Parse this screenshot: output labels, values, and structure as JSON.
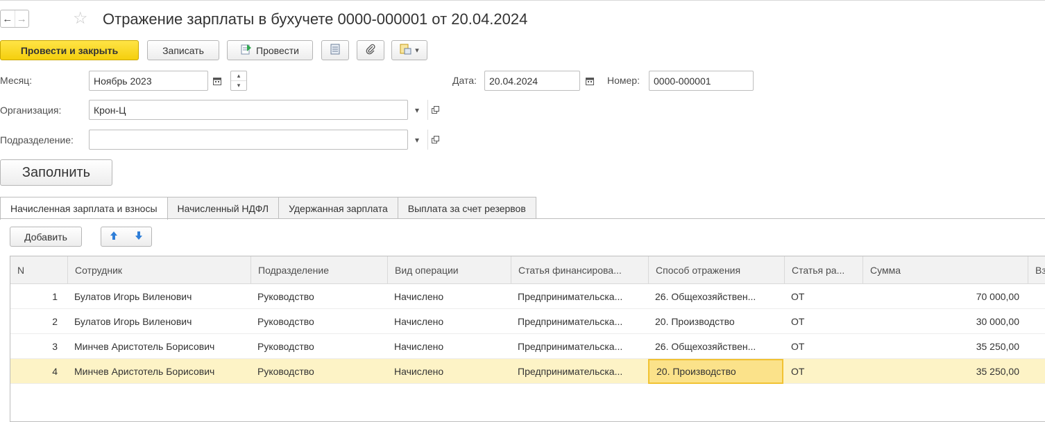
{
  "window": {
    "title": "Отражение зарплаты в бухучете 0000-000001 от 20.04.2024",
    "back_glyph": "←",
    "forward_glyph": "→",
    "star_glyph": "☆"
  },
  "toolbar": {
    "post_close_label": "Провести и закрыть",
    "save_label": "Записать",
    "post_label": "Провести",
    "more_glyph": "▾"
  },
  "form": {
    "month_label": "Месяц:",
    "month_value": "Ноябрь 2023",
    "date_label": "Дата:",
    "date_value": "20.04.2024",
    "number_label": "Номер:",
    "number_value": "0000-000001",
    "org_label": "Организация:",
    "org_value": "Крон-Ц",
    "dept_label": "Подразделение:",
    "dept_value": "",
    "fill_label": "Заполнить"
  },
  "tabs": [
    {
      "label": "Начисленная зарплата и взносы",
      "active": true
    },
    {
      "label": "Начисленный НДФЛ",
      "active": false
    },
    {
      "label": "Удержанная зарплата",
      "active": false
    },
    {
      "label": "Выплата за счет резервов",
      "active": false
    }
  ],
  "table_toolbar": {
    "add_label": "Добавить"
  },
  "table": {
    "columns": [
      "N",
      "Сотрудник",
      "Подразделение",
      "Вид операции",
      "Статья финансирова...",
      "Способ отражения",
      "Статья ра...",
      "Сумма",
      "Вз"
    ],
    "rows": [
      {
        "n": "1",
        "employee": "Булатов Игорь Виленович",
        "dept": "Руководство",
        "operation": "Начислено",
        "financing": "Предпринимательска...",
        "method": "26. Общехозяйствен...",
        "article": "ОТ",
        "sum": "70 000,00",
        "selected": false
      },
      {
        "n": "2",
        "employee": "Булатов Игорь Виленович",
        "dept": "Руководство",
        "operation": "Начислено",
        "financing": "Предпринимательска...",
        "method": "20. Производство",
        "article": "ОТ",
        "sum": "30 000,00",
        "selected": false
      },
      {
        "n": "3",
        "employee": "Минчев Аристотель Борисович",
        "dept": "Руководство",
        "operation": "Начислено",
        "financing": "Предпринимательска...",
        "method": "26. Общехозяйствен...",
        "article": "ОТ",
        "sum": "35 250,00",
        "selected": false
      },
      {
        "n": "4",
        "employee": "Минчев Аристотель Борисович",
        "dept": "Руководство",
        "operation": "Начислено",
        "financing": "Предпринимательска...",
        "method": "20. Производство",
        "article": "ОТ",
        "sum": "35 250,00",
        "selected": true
      }
    ]
  },
  "colors": {
    "primary_button": "#f5cf0d",
    "selected_row": "#fdf3c6",
    "current_cell": "#fbe28a",
    "arrow_icon": "#2f7ed8"
  }
}
